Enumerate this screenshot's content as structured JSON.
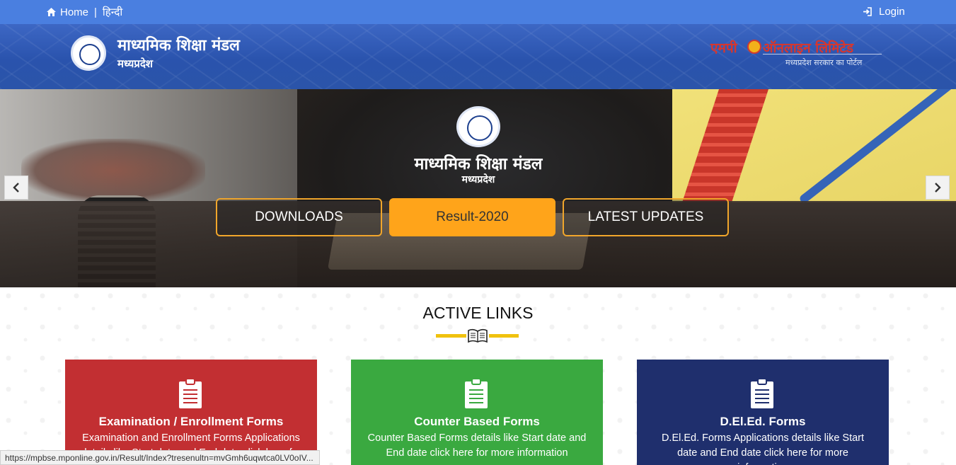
{
  "topbar": {
    "home_label": "Home",
    "separator": "|",
    "hindi_label": "हिन्दी",
    "login_label": "Login",
    "icons": {
      "home": "home-icon",
      "login": "sign-in-icon"
    }
  },
  "header": {
    "org_title": "माध्यमिक शिक्षा मंडल",
    "org_subtitle": "मध्यप्रदेश",
    "partner_logo": {
      "part1": "एमपी",
      "part2": "ऑनलाइन लिमिटेड",
      "tagline": "मध्यप्रदेश सरकार का पोर्टल"
    }
  },
  "banner": {
    "title": "माध्यमिक शिक्षा मंडल",
    "subtitle": "मध्यप्रदेश",
    "buttons": {
      "downloads": "DOWNLOADS",
      "result": "Result-2020",
      "latest": "LATEST UPDATES"
    },
    "prev_arrow": "‹",
    "next_arrow": "›"
  },
  "active_links": {
    "title": "ACTIVE LINKS",
    "cards": [
      {
        "title": "Examination / Enrollment Forms",
        "desc": "Examination and Enrollment Forms Applications details like Start date and End date click here for more information"
      },
      {
        "title": "Counter Based Forms",
        "desc": "Counter Based Forms details like Start date and End date click here for more information"
      },
      {
        "title": "D.El.Ed. Forms",
        "desc": "D.El.Ed. Forms Applications details like Start date and End date click here for more information"
      }
    ]
  },
  "status_url": "https://mpbse.mponline.gov.in/Result/Index?tresenultn=mvGmh6uqwtca0LV0oIV...",
  "colors": {
    "topbar": "#4a7fe0",
    "header": "#2a53ad",
    "accent_orange": "#ffa41a",
    "card_red": "#c22f32",
    "card_green": "#3aa940",
    "card_navy": "#1f2f6d",
    "underline_yellow": "#f0c20e"
  }
}
